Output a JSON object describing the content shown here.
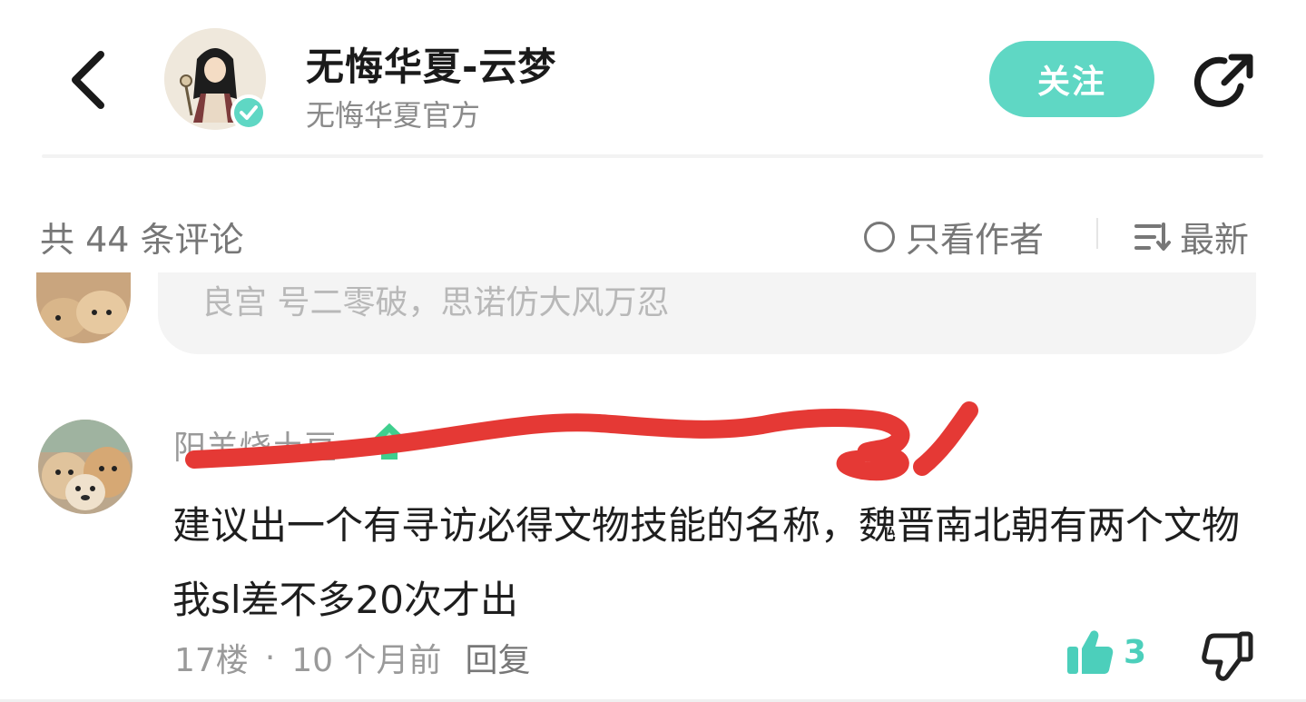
{
  "header": {
    "title": "无悔华夏-云梦",
    "subtitle": "无悔华夏官方",
    "follow_label": "关注"
  },
  "comment_bar": {
    "count_text": "共 44 条评论",
    "author_only_label": "只看作者",
    "sort_label": "最新"
  },
  "previous_comment": {
    "partial_text": "良宫 号二零破，思诺仿大风万忍"
  },
  "comment": {
    "username": "阳羊烧土豆",
    "body": "建议出一个有寻访必得文物技能的名称，魏晋南北朝有两个文物我sl差不多20次才出",
    "floor": "17楼",
    "time": "10 个月前",
    "reply_label": "回复",
    "like_count": "3"
  },
  "colors": {
    "accent": "#5fd7c4",
    "like": "#4ccfbb",
    "scribble": "#e53935"
  },
  "icons": {
    "back": "chevron-left-icon",
    "share": "share-icon",
    "verified": "verified-check-icon",
    "sort": "sort-lines-icon",
    "level": "level-badge-icon",
    "like": "thumbs-up-icon",
    "dislike": "thumbs-down-icon"
  }
}
